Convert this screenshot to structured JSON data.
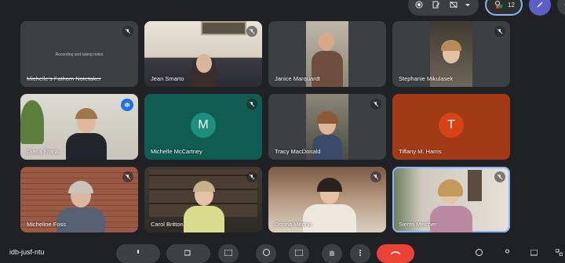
{
  "topbar": {
    "participants_count": "12",
    "icons": [
      "record-icon",
      "edit-icon",
      "no-camera-icon",
      "chevron-down-icon",
      "people-icon",
      "pen-icon",
      "sparkle-icon"
    ]
  },
  "tiles": [
    {
      "name": "Michelle's Fathom Notetaker",
      "note": "Recording and taking notes",
      "muted": true
    },
    {
      "name": "Jean Smarto",
      "muted": true
    },
    {
      "name": "Janice Marquardt",
      "muted": false
    },
    {
      "name": "Stephanie Mikulasek",
      "muted": true
    },
    {
      "name": "Diana Frank",
      "speaking": true
    },
    {
      "name": "Michelle McCartney",
      "initial": "M",
      "muted": true
    },
    {
      "name": "Tracy MacDonald",
      "muted": true
    },
    {
      "name": "Tiffany M. Harris",
      "initial": "T"
    },
    {
      "name": "Micheline Foss",
      "muted": true
    },
    {
      "name": "Carol Britton",
      "muted": true
    },
    {
      "name": "Donna Medno",
      "muted": true
    },
    {
      "name": "Sierra Melcher",
      "muted": true
    }
  ],
  "bottombar": {
    "meeting_code": "idb-jusf-ntu"
  },
  "colors": {
    "background": "#202124",
    "tile": "#3c4043",
    "avatar_teal": "#1e8e7e",
    "avatar_orange": "#d84315",
    "tile_orange": "#a33a17",
    "tile_teal": "#0e5c52",
    "leave_red": "#ea4335",
    "accent_blue": "#8ab4f8"
  }
}
